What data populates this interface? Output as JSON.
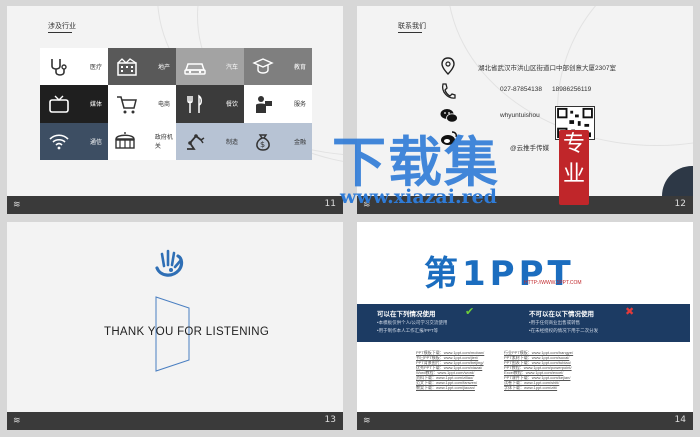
{
  "slide11": {
    "title": "涉及行业",
    "page": "11",
    "footer_left": "≋",
    "cells": [
      {
        "label": "医疗",
        "icon": "stethoscope-icon",
        "bg": "#ffffff",
        "fg": "#333333"
      },
      {
        "label": "地产",
        "icon": "building-icon",
        "bg": "#595959",
        "fg": "#ffffff"
      },
      {
        "label": "汽车",
        "icon": "car-icon",
        "bg": "#a3a3a3",
        "fg": "#ffffff"
      },
      {
        "label": "教育",
        "icon": "graduate-icon",
        "bg": "#7f7f7f",
        "fg": "#ffffff"
      },
      {
        "label": "媒体",
        "icon": "tv-icon",
        "bg": "#1f1f1f",
        "fg": "#ffffff"
      },
      {
        "label": "电商",
        "icon": "cart-icon",
        "bg": "#ffffff",
        "fg": "#333333"
      },
      {
        "label": "餐饮",
        "icon": "cutlery-icon",
        "bg": "#3b3b3b",
        "fg": "#ffffff"
      },
      {
        "label": "服务",
        "icon": "service-icon",
        "bg": "#ffffff",
        "fg": "#333333"
      },
      {
        "label": "通信",
        "icon": "wifi-icon",
        "bg": "#3d4e63",
        "fg": "#ffffff"
      },
      {
        "label": "政府机关",
        "icon": "government-icon",
        "bg": "#ffffff",
        "fg": "#333333"
      },
      {
        "label": "制造",
        "icon": "robot-arm-icon",
        "bg": "#b7c3d4",
        "fg": "#333333"
      },
      {
        "label": "金融",
        "icon": "money-bag-icon",
        "bg": "#b7c3d4",
        "fg": "#333333"
      }
    ]
  },
  "slide12": {
    "title": "联系我们",
    "page": "12",
    "footer_left": "≋",
    "address": "湖北省武汉市洪山区街道口中部创意大厦2307室",
    "phone1": "027-87854138",
    "phone2": "18986256119",
    "wechat": "whyuntuishou",
    "weibo": "@云推手传媒"
  },
  "slide13": {
    "thanks": "THANK YOU FOR LISTENING",
    "page": "13",
    "footer_left": "≋"
  },
  "slide14": {
    "page": "14",
    "footer_left": "≋",
    "logo_main": "第1PPT",
    "logo_url": "HTTP://WWW.1PPT.COM",
    "can_title": "可以在下列情况使用",
    "cannot_title": "不可以在以下情况使用",
    "can_lines": [
      "•本模板仅供个人/公司学习交流使用",
      "•用于制作本人工作汇报/PPT等"
    ],
    "cannot_lines": [
      "•用于任何商业出售或转售",
      "•在未经授权的情况下用于二次分发"
    ],
    "links_left": [
      "PPT模板下载：www.1ppt.com/moban/",
      "节日PPT模板：www.1ppt.com/jieri/",
      "PPT背景图片：www.1ppt.com/beijing/",
      "优秀PPT下载：www.1ppt.com/xiazai/",
      "Word教程：www.1ppt.com/word/",
      "资料下载：www.1ppt.com/ziliao/",
      "范文下载：www.1ppt.com/fanwen/",
      "教案下载：www.1ppt.com/jiaoan/"
    ],
    "links_right": [
      "行业PPT模板：www.1ppt.com/hangye/",
      "PPT素材下载：www.1ppt.com/sucai/",
      "PPT图表下载：www.1ppt.com/tubiao/",
      "PPT教程：www.1ppt.com/powerpoint/",
      "Excel教程：www.1ppt.com/excel/",
      "PPT课件下载：www.1ppt.com/kejian/",
      "试卷下载：www.1ppt.com/shiti/",
      "字体下载：www.1ppt.com/ziti/"
    ]
  },
  "watermark": {
    "main": "下载集",
    "url": "www.xiazai.red",
    "seal": "专业",
    "color": "#2e7bd7",
    "seal_color": "#c0262a"
  }
}
